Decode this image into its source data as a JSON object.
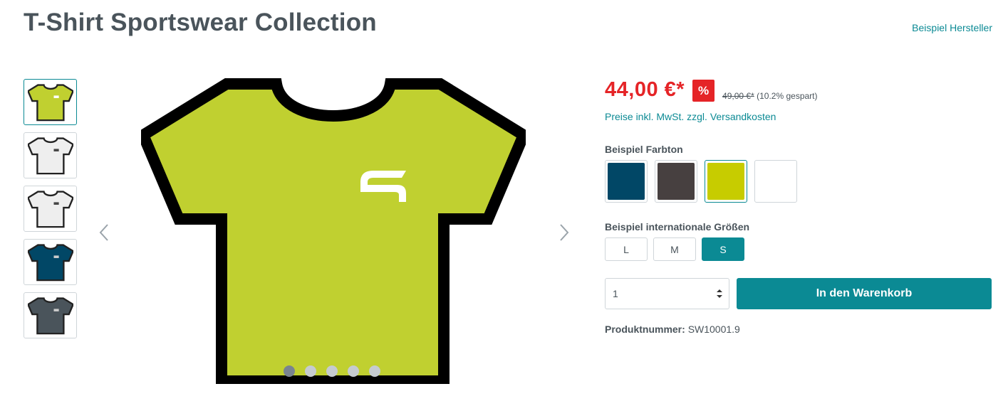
{
  "product": {
    "title": "T-Shirt Sportswear Collection",
    "manufacturer": "Beispiel Hersteller"
  },
  "gallery": {
    "thumbnails": [
      {
        "color": "#c0d030",
        "logo": "#ffffff",
        "selected": true
      },
      {
        "color": "#eeeeee",
        "logo": "#444444",
        "selected": false
      },
      {
        "color": "#eeeeee",
        "logo": "#444444",
        "selected": false
      },
      {
        "color": "#014766",
        "logo": "#cccccc",
        "selected": false
      },
      {
        "color": "#4a545b",
        "logo": "#cccccc",
        "selected": false
      }
    ],
    "main_color": "#c0d030",
    "main_logo_color": "#ffffff",
    "prev_icon": "chevron-left-icon",
    "next_icon": "chevron-right-icon",
    "dots_count": 5,
    "active_dot": 1
  },
  "price": {
    "current": "44,00 €*",
    "badge": "%",
    "old": "49,00 €*",
    "savings": "(10.2% gespart)",
    "tax_note": "Preise inkl. MwSt. zzgl. Versandkosten"
  },
  "options": {
    "color_title": "Beispiel Farbton",
    "colors": [
      {
        "hex": "#014766",
        "selected": false
      },
      {
        "hex": "#474040",
        "selected": false
      },
      {
        "hex": "#c7cc00",
        "selected": true
      },
      {
        "hex": "#ffffff",
        "selected": false
      }
    ],
    "size_title": "Beispiel internationale Größen",
    "sizes": [
      {
        "label": "L",
        "selected": false
      },
      {
        "label": "M",
        "selected": false
      },
      {
        "label": "S",
        "selected": true
      }
    ]
  },
  "cart": {
    "quantity": "1",
    "button_label": "In den Warenkorb"
  },
  "sku": {
    "label": "Produktnummer:",
    "value": "SW10001.9"
  },
  "colors": {
    "accent": "#0b8a94",
    "sale": "#e52427"
  }
}
